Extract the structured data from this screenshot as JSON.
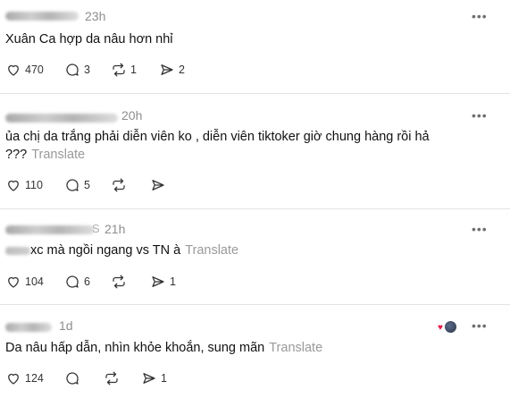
{
  "comments": [
    {
      "time": "23h",
      "text": "Xuân Ca hợp da nâu hơn nhỉ",
      "translate": "",
      "actions": {
        "likes": "470",
        "replies": "3",
        "reposts": "1",
        "shares": "2"
      }
    },
    {
      "time": "20h",
      "text_line1": "ủa chị da trắng phải diễn viên ko , diễn viên tiktoker giờ chung hàng rồi hả",
      "text_line2": "???",
      "translate": "Translate",
      "actions": {
        "likes": "110",
        "replies": "5",
        "reposts": "",
        "shares": ""
      }
    },
    {
      "time": "21h",
      "username_tail": "S",
      "text": "xc mà ngồi ngang vs TN à",
      "translate": "Translate",
      "actions": {
        "likes": "104",
        "replies": "6",
        "reposts": "",
        "shares": "1"
      }
    },
    {
      "time": "1d",
      "text": "Da nâu hấp dẫn, nhìn khỏe khoắn, sung mãn",
      "translate": "Translate",
      "actions": {
        "likes": "124",
        "replies": "",
        "reposts": "",
        "shares": "1"
      }
    }
  ],
  "more_label": "•••",
  "icons": [
    "heart-icon",
    "reply-icon",
    "repost-icon",
    "share-icon"
  ],
  "colors": {
    "time": "#8e8e8e",
    "translate": "#9a9a9a",
    "divider": "#e3e3e3",
    "reaction_heart": "#e8194a"
  }
}
